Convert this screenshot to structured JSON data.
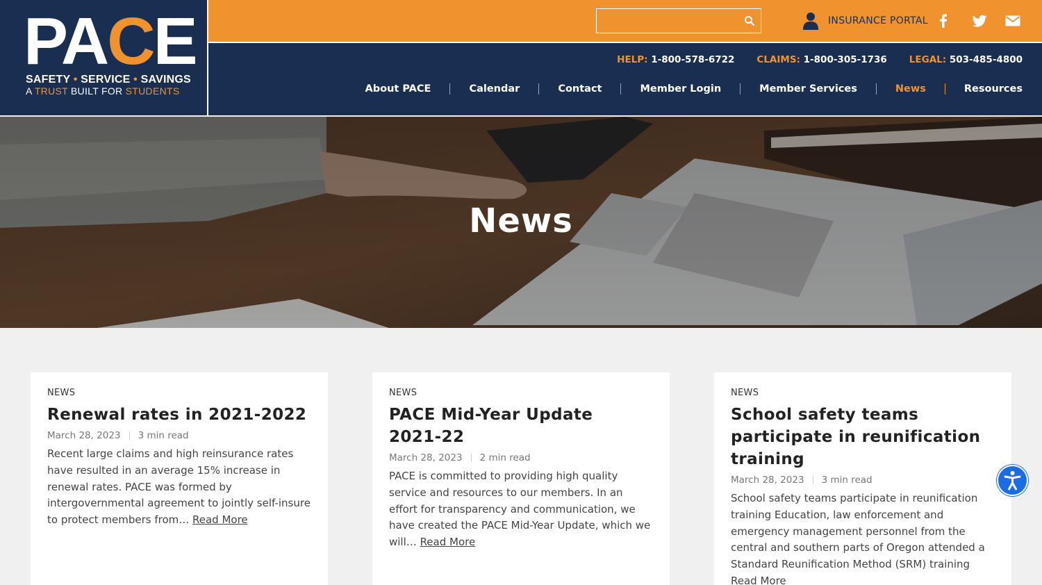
{
  "logo": {
    "word_a": "PA",
    "word_c": "C",
    "word_e": "E",
    "tag1": [
      "SAFETY",
      "SERVICE",
      "SAVINGS"
    ],
    "tag_dot": "•",
    "tag2_a": "A ",
    "tag2_trust": "TRUST",
    "tag2_mid": " BUILT FOR ",
    "tag2_students": "STUDENTS"
  },
  "search": {
    "placeholder": "",
    "icon": "search-icon"
  },
  "portal": {
    "label": "INSURANCE PORTAL",
    "icon": "user-icon"
  },
  "social": [
    {
      "name": "facebook-icon"
    },
    {
      "name": "twitter-icon"
    },
    {
      "name": "email-icon"
    }
  ],
  "contacts": [
    {
      "label": "HELP:",
      "number": "1-800-578-6722"
    },
    {
      "label": "CLAIMS:",
      "number": "1-800-305-1736"
    },
    {
      "label": "LEGAL:",
      "number": "503-485-4800"
    }
  ],
  "menu": [
    {
      "label": "About PACE",
      "active": false
    },
    {
      "label": "Calendar",
      "active": false
    },
    {
      "label": "Contact",
      "active": false
    },
    {
      "label": "Member Login",
      "active": false
    },
    {
      "label": "Member Services",
      "active": false
    },
    {
      "label": "News",
      "active": true
    },
    {
      "label": "Resources",
      "active": false
    }
  ],
  "hero": {
    "title": "News"
  },
  "cards": [
    {
      "category": "NEWS",
      "title": "Renewal rates in 2021-2022",
      "date": "March 28, 2023",
      "read_time": "3 min read",
      "excerpt": "Recent large claims and high reinsurance rates have resulted in an average 15% increase in renewal rates. PACE was formed by intergovernmental agreement to jointly self-insure to protect members from…",
      "read_more": "Read More"
    },
    {
      "category": "NEWS",
      "title": "PACE Mid-Year Update 2021-22",
      "date": "March 28, 2023",
      "read_time": "2 min read",
      "excerpt": "PACE is committed to providing high quality service and resources to our members. In an effort for transparency and communication, we have created the PACE Mid-Year Update, which we will…",
      "read_more": "Read More"
    },
    {
      "category": "NEWS",
      "title": "School safety teams participate in reunification training",
      "date": "March 28, 2023",
      "read_time": "3 min read",
      "excerpt": "School safety teams participate in reunification training Education, law enforcement and emergency management personnel from the central and southern parts of Oregon attended a Standard Reunification Method (SRM) training",
      "read_more": "Read More"
    }
  ],
  "colors": {
    "navy": "#1a2e52",
    "orange": "#f0932e",
    "bg": "#f0f0f0"
  }
}
